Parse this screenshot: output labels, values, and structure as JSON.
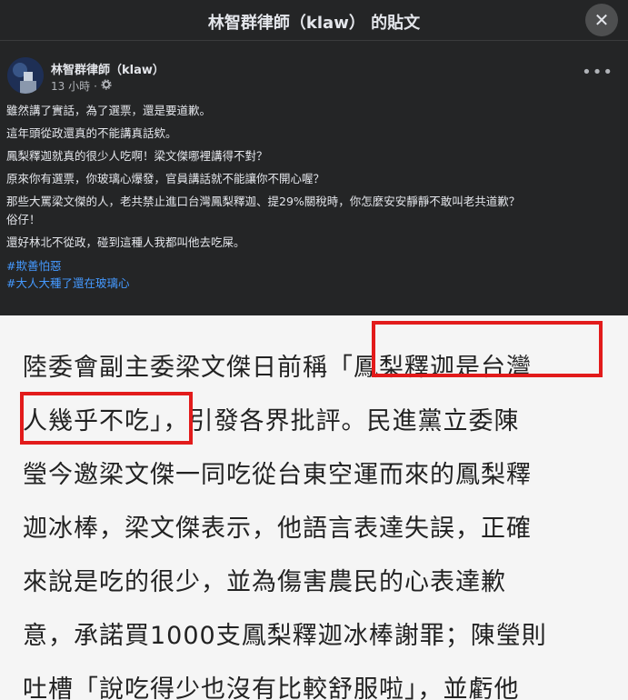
{
  "header": {
    "title": "林智群律師（klaw） 的貼文",
    "close_icon": "close-icon"
  },
  "post": {
    "author": "林智群律師（klaw）",
    "time": "13 小時",
    "privacy_icon": "gear-icon",
    "more_icon": "more-horizontal-icon",
    "paragraphs": [
      "雖然講了實話，為了選票，還是要道歉。",
      "這年頭從政還真的不能講真話欸。",
      "鳳梨釋迦就真的很少人吃啊！梁文傑哪裡講得不對？",
      "原來你有選票，你玻璃心爆發，官員講話就不能讓你不開心喔？",
      "那些大罵梁文傑的人，老共禁止進口台灣鳳梨釋迦、提29%關稅時，你怎麼安安靜靜不敢叫老共道歉？",
      "俗仔！",
      "還好林北不從政，碰到這種人我都叫他去吃屎。"
    ],
    "hashtags": [
      "#欺善怕惡",
      "#大人大種了還在玻璃心"
    ]
  },
  "article_image": {
    "lines": [
      "陸委會副主委梁文傑日前稱「鳳梨釋迦是台灣",
      "人幾乎不吃」，引發各界批評。民進黨立委陳",
      "瑩今邀梁文傑一同吃從台東空運而來的鳳梨釋",
      "迦冰棒，梁文傑表示，他語言表達失誤，正確",
      "來說是吃的很少，並為傷害農民的心表達歉",
      "意，承諾買1000支鳳梨釋迦冰棒謝罪；陳瑩則",
      "吐槽「說吃得少也沒有比較舒服啦」，並虧他"
    ],
    "highlight_color": "#e21b1b"
  }
}
